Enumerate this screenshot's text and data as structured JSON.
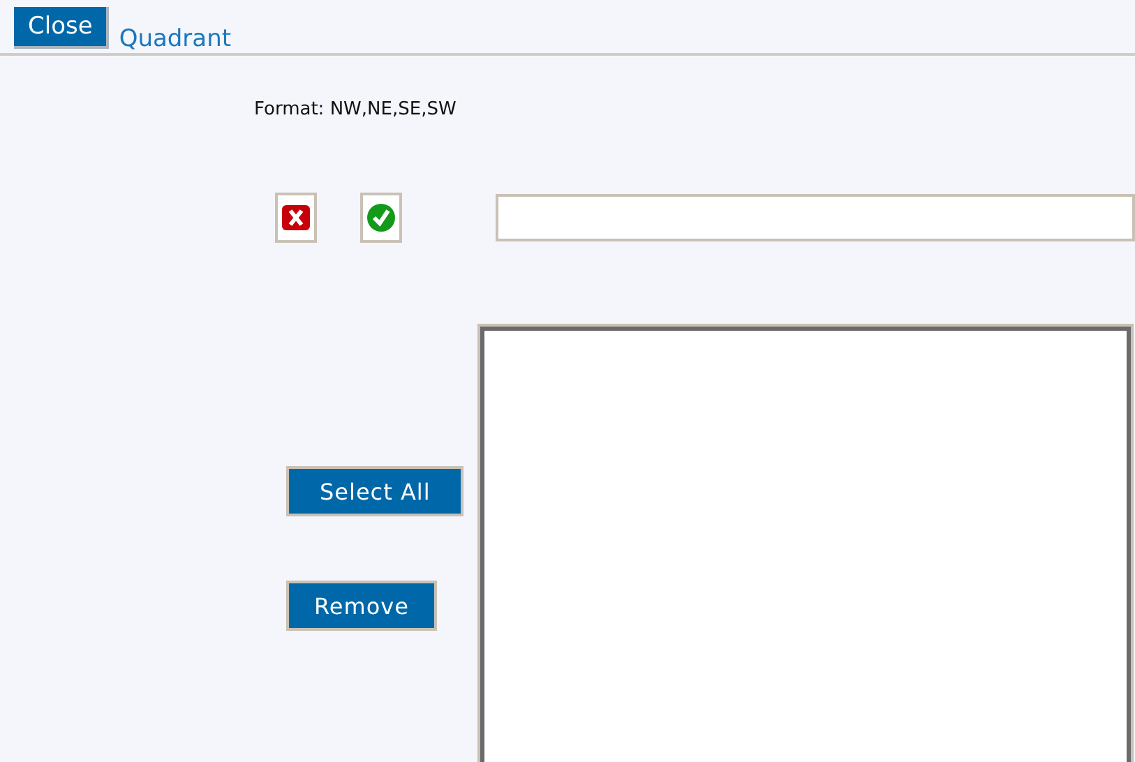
{
  "header": {
    "close_button": "Close",
    "title": "Quadrant"
  },
  "format_hint": "Format: NW,NE,SE,SW",
  "buttons": [
    {
      "label": "Select All"
    },
    {
      "label": "Remove"
    }
  ]
}
